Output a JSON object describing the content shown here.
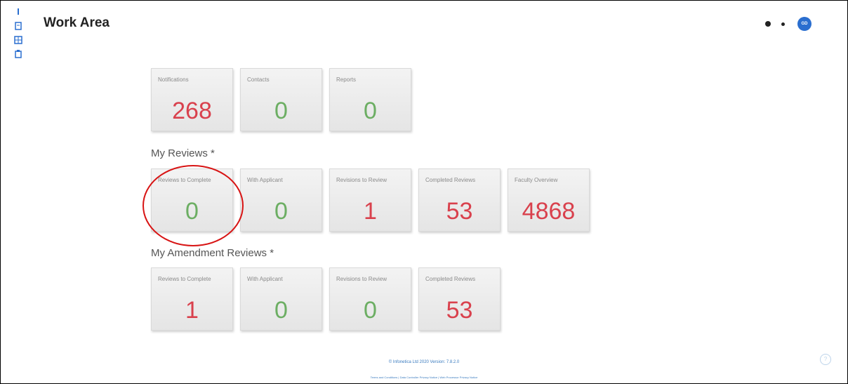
{
  "header": {
    "title": "Work Area",
    "avatar_initials": "GD"
  },
  "tiles_top": [
    {
      "label": "Notifications",
      "value": "268",
      "color": "red"
    },
    {
      "label": "Contacts",
      "value": "0",
      "color": "green"
    },
    {
      "label": "Reports",
      "value": "0",
      "color": "green"
    }
  ],
  "my_reviews": {
    "title": "My Reviews *",
    "tiles": [
      {
        "label": "Reviews to Complete",
        "value": "0",
        "color": "green"
      },
      {
        "label": "With Applicant",
        "value": "0",
        "color": "green"
      },
      {
        "label": "Revisions to Review",
        "value": "1",
        "color": "red"
      },
      {
        "label": "Completed Reviews",
        "value": "53",
        "color": "red"
      },
      {
        "label": "Faculty Overview",
        "value": "4868",
        "color": "red"
      }
    ]
  },
  "amendment_reviews": {
    "title": "My Amendment Reviews *",
    "tiles": [
      {
        "label": "Reviews to Complete",
        "value": "1",
        "color": "red"
      },
      {
        "label": "With Applicant",
        "value": "0",
        "color": "green"
      },
      {
        "label": "Revisions to Review",
        "value": "0",
        "color": "green"
      },
      {
        "label": "Completed Reviews",
        "value": "53",
        "color": "red"
      }
    ]
  },
  "footer": {
    "line1": "© Infonetica Ltd 2020 Version: 7.8.2.0",
    "line2": "Terms and Conditions | Data Controller Privacy Notice | Web Processor Privacy Notice"
  },
  "colors": {
    "red": "#d9414d",
    "green": "#6cae63",
    "accent": "#2a6ecf",
    "annotation": "#d81414"
  }
}
